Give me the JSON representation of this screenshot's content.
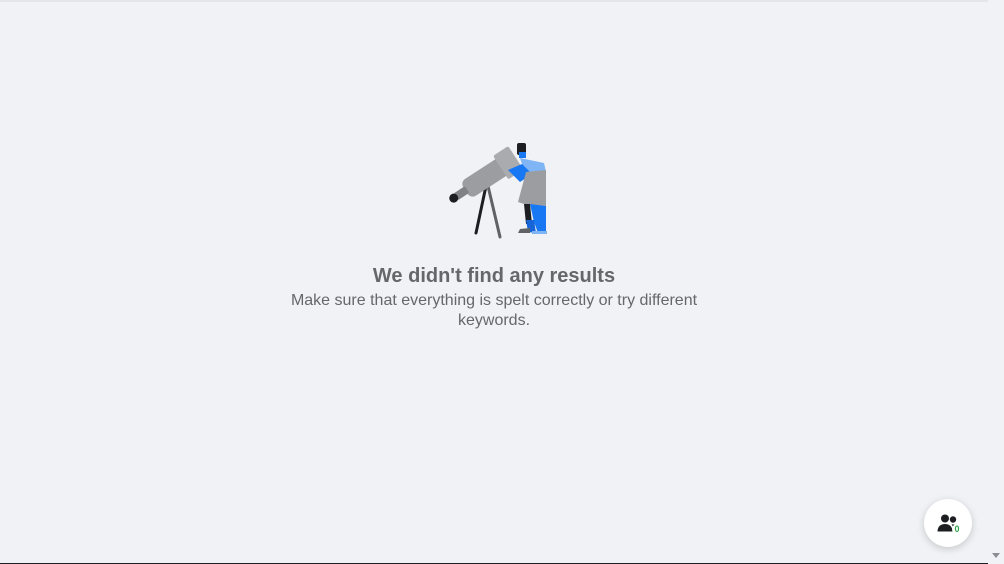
{
  "empty_state": {
    "title": "We didn't find any results",
    "subtitle": "Make sure that everything is spelt correctly or try different keywords.",
    "illustration_icon": "telescope-person-icon"
  },
  "friends_button": {
    "icon": "people-icon",
    "count": "0",
    "count_color": "#31a24c"
  },
  "colors": {
    "background": "#f0f2f5",
    "text_secondary": "#65676b",
    "accent_blue": "#1877f2",
    "light_blue": "#7fb4f5",
    "telescope_gray": "#9b9da1"
  }
}
